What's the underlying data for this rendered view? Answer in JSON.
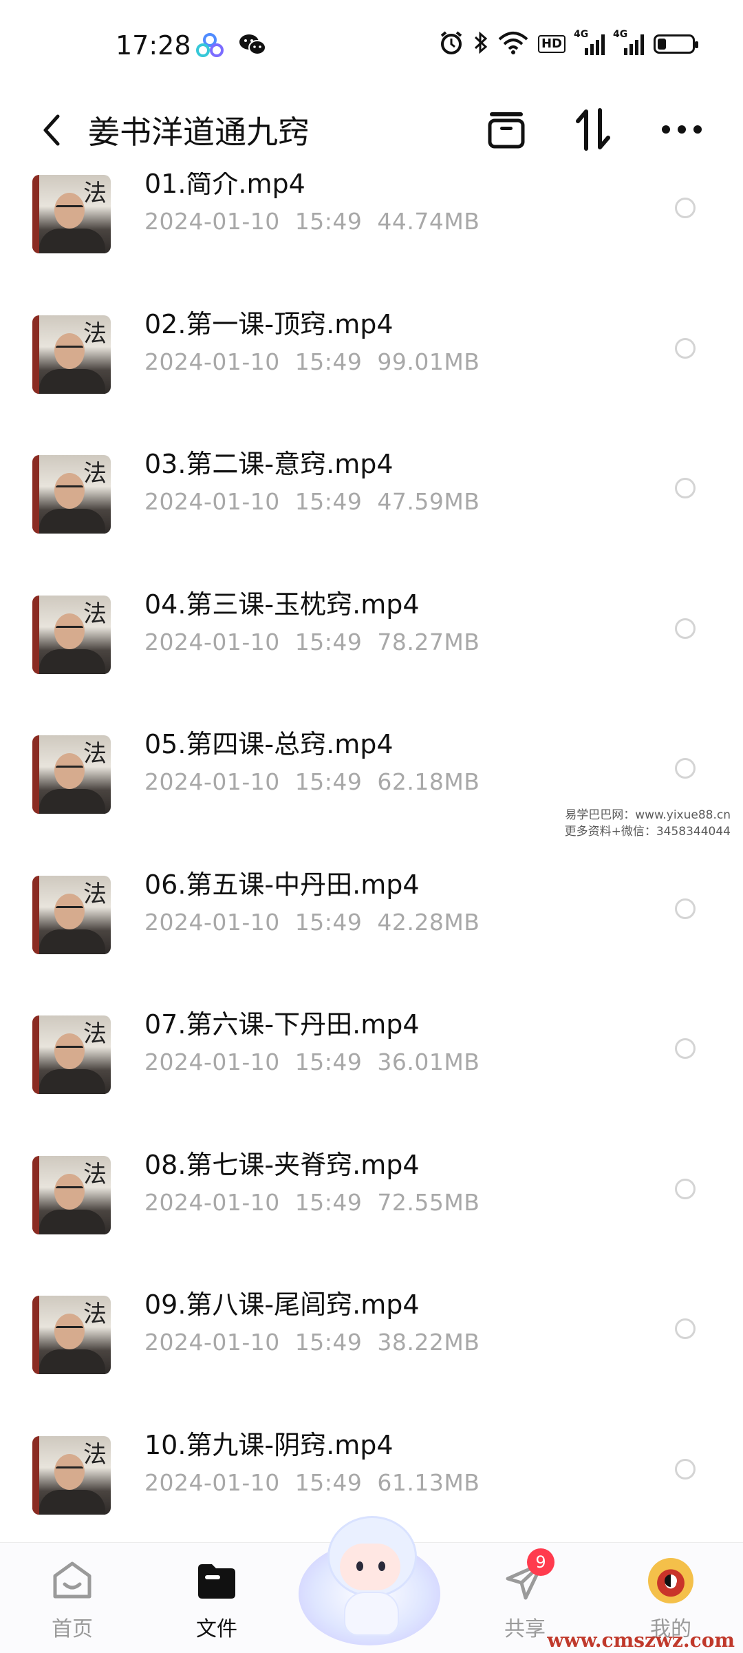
{
  "status_bar": {
    "time": "17:28",
    "hd_label": "HD",
    "net_labels": [
      "4G",
      "4G"
    ],
    "battery_level": 0.25,
    "icons": [
      "baidu-cloud-icon",
      "wechat-icon",
      "alarm-icon",
      "bluetooth-icon",
      "wifi-icon",
      "hd-icon",
      "signal-4g-icon",
      "signal-4g-icon",
      "battery-icon"
    ]
  },
  "header": {
    "title": "姜书洋道通九窍",
    "icons": [
      "back-icon",
      "select-icon",
      "sort-icon",
      "more-icon"
    ]
  },
  "files": [
    {
      "name": "01.简介.mp4",
      "date": "2024-01-10",
      "time": "15:49",
      "size": "44.74MB"
    },
    {
      "name": "02.第一课-顶窍.mp4",
      "date": "2024-01-10",
      "time": "15:49",
      "size": "99.01MB"
    },
    {
      "name": "03.第二课-意窍.mp4",
      "date": "2024-01-10",
      "time": "15:49",
      "size": "47.59MB"
    },
    {
      "name": "04.第三课-玉枕窍.mp4",
      "date": "2024-01-10",
      "time": "15:49",
      "size": "78.27MB"
    },
    {
      "name": "05.第四课-总窍.mp4",
      "date": "2024-01-10",
      "time": "15:49",
      "size": "62.18MB"
    },
    {
      "name": "06.第五课-中丹田.mp4",
      "date": "2024-01-10",
      "time": "15:49",
      "size": "42.28MB"
    },
    {
      "name": "07.第六课-下丹田.mp4",
      "date": "2024-01-10",
      "time": "15:49",
      "size": "36.01MB"
    },
    {
      "name": "08.第七课-夹脊窍.mp4",
      "date": "2024-01-10",
      "time": "15:49",
      "size": "72.55MB"
    },
    {
      "name": "09.第八课-尾闾窍.mp4",
      "date": "2024-01-10",
      "time": "15:49",
      "size": "38.22MB"
    },
    {
      "name": "10.第九课-阴窍.mp4",
      "date": "2024-01-10",
      "time": "15:49",
      "size": "61.13MB"
    }
  ],
  "watermark": {
    "line1": "易学巴巴网：www.yixue88.cn",
    "line2": "更多资料+微信：3458344044"
  },
  "bottom_nav": {
    "items": [
      {
        "label": "首页",
        "icon": "home-icon",
        "active": false
      },
      {
        "label": "文件",
        "icon": "folder-icon",
        "active": true
      },
      {
        "label": "共享",
        "icon": "share-plane-icon",
        "active": false,
        "badge": "9"
      },
      {
        "label": "我的",
        "icon": "profile-avatar-icon",
        "active": false
      }
    ],
    "center_icon": "assistant-mascot-icon"
  },
  "site_mark": "www.cmszwz.com",
  "colors": {
    "text_primary": "#111111",
    "text_secondary": "#a8a8a8",
    "badge": "#ff3b4e",
    "radio_border": "#d4d4d4"
  }
}
